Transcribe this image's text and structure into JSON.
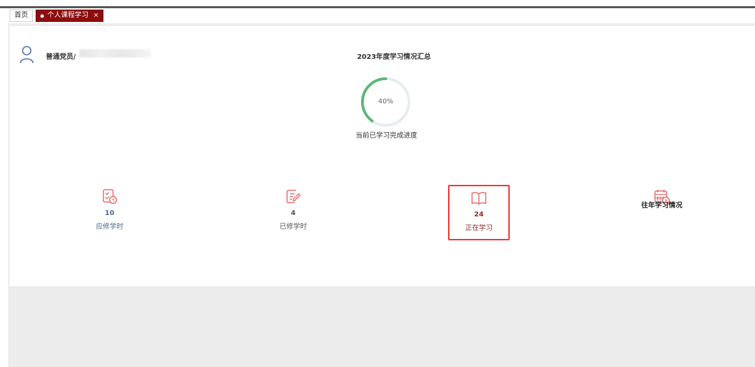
{
  "tabs": {
    "home": "首页",
    "current": "个人课程学习",
    "close": "×"
  },
  "user": {
    "label": "普通党员/"
  },
  "summary": {
    "title": "2023年度学习情况汇总",
    "progress_percent": 40,
    "progress_text": "40%",
    "caption": "当前已学习完成进度",
    "progress_color": "#5cb67a",
    "track_color": "#e7ecef"
  },
  "stats": [
    {
      "value": "10",
      "label": "应修学时",
      "icon": "checklist-clock-icon",
      "color": "#4a6a8e"
    },
    {
      "value": "4",
      "label": "已修学时",
      "icon": "document-edit-icon",
      "color": "#555555"
    },
    {
      "value": "24",
      "label": "正在学习",
      "icon": "open-book-icon",
      "color": "#8b2b2b"
    },
    {
      "value": "",
      "label": "往年学习情况",
      "icon": "calendar-clock-icon",
      "color": "#222222"
    }
  ]
}
